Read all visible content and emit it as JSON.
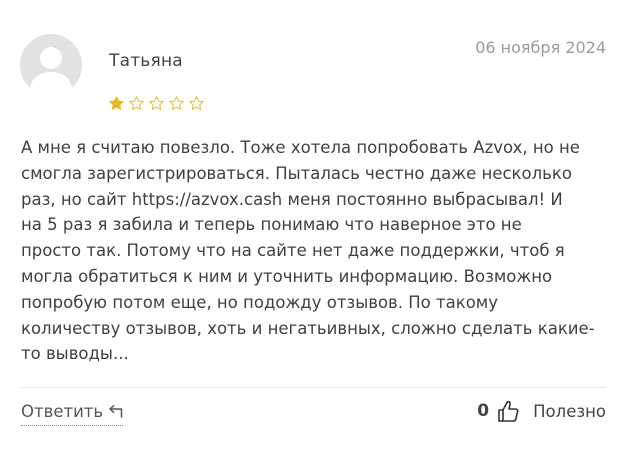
{
  "review": {
    "author": "Татьяна",
    "date": "06 ноября 2024",
    "rating": 1,
    "rating_max": 5,
    "text": "А мне я считаю повезло. Тоже хотела попробовать Azvox, но не\nсмогла зарегистрироваться. Пыталась честно даже несколько\nраз, но сайт https://azvox.cash меня постоянно выбрасывал! И\nна 5 раз я забила и теперь понимаю что наверное это не\nпросто так. Потому что на сайте нет даже поддержки, чтоб я\nмогла обратиться к ним и уточнить информацию. Возможно\nпопробую потом еще, но подожду отзывов. По такому\nколичеству отзывов, хоть и негатьивных, сложно сделать какие-\nто выводы...",
    "reply_label": "Ответить",
    "helpful_count": "0",
    "helpful_label": "Полезно"
  },
  "icons": {
    "avatar": "user-silhouette-icon",
    "star_filled": "star-filled-icon",
    "star_empty": "star-outline-icon",
    "reply": "reply-arrow-icon",
    "thumb": "thumbs-up-icon"
  },
  "colors": {
    "star": "#e8b923",
    "avatar_bg": "#e2e2e2",
    "avatar_fg": "#ffffff",
    "date": "#9b9b9b",
    "text": "#404040"
  }
}
